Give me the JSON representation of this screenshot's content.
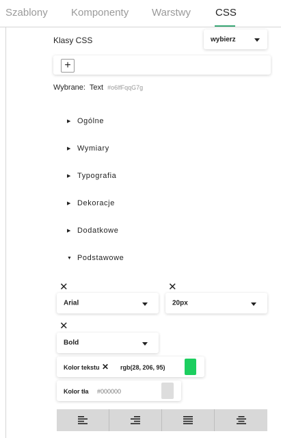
{
  "tabs": [
    {
      "label": "Szablony"
    },
    {
      "label": "Komponenty"
    },
    {
      "label": "Warstwy"
    },
    {
      "label": "CSS"
    }
  ],
  "classes": {
    "label": "Klasy CSS",
    "select_value": "wybierz",
    "add_symbol": "+"
  },
  "selected": {
    "label": "Wybrane:",
    "name": "Text",
    "id": "#o6lfFqqG7g"
  },
  "sections": [
    {
      "label": "Ogólne",
      "expanded": false
    },
    {
      "label": "Wymiary",
      "expanded": false
    },
    {
      "label": "Typografia",
      "expanded": false
    },
    {
      "label": "Dekoracje",
      "expanded": false
    },
    {
      "label": "Dodatkowe",
      "expanded": false
    },
    {
      "label": "Podstawowe",
      "expanded": true
    }
  ],
  "properties": {
    "font_family": "Arial",
    "font_size": "20px",
    "font_weight": "Bold",
    "text_color_label": "Kolor tekstu",
    "text_color_value": "rgb(28, 206, 95)",
    "text_color_swatch": "#1cce5f",
    "bg_color_label": "Kolor tła",
    "bg_color_placeholder": "#000000",
    "bg_color_swatch": "#dddddd"
  },
  "align": [
    {
      "name": "align-left-icon"
    },
    {
      "name": "align-right-icon"
    },
    {
      "name": "align-justify-icon"
    },
    {
      "name": "align-center-icon"
    }
  ],
  "accent_color": "#3aa876"
}
